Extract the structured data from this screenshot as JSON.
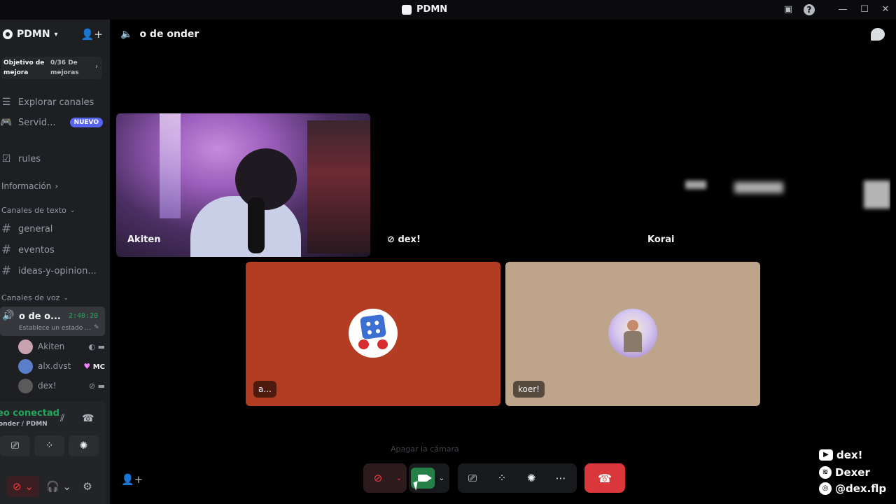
{
  "window": {
    "title": "PDMN"
  },
  "server": {
    "name": "PDMN",
    "boost": {
      "goal_label": "Objetivo de mejora",
      "progress": "0/36 De mejoras"
    }
  },
  "nav": {
    "explore": "Explorar canales",
    "servers": "Servid...",
    "servers_badge": "NUEVO",
    "rules": "rules"
  },
  "categories": {
    "info": "Información",
    "text": "Canales de texto",
    "voice": "Canales de voz"
  },
  "text_channels": [
    "general",
    "eventos",
    "ideas-y-opinion..."
  ],
  "voice_channel": {
    "name": "o de o...",
    "timer": "2:40:20",
    "status": "Establece un estado ...",
    "members": [
      {
        "name": "Akiten",
        "avatar_color": "#c9a2b0"
      },
      {
        "name": "alx.dvst",
        "tag": "MC",
        "avatar_color": "#5b7ec9"
      },
      {
        "name": "dex!",
        "avatar_color": "#5a5a5a"
      }
    ]
  },
  "connection": {
    "status": "eo conectad",
    "location": "onder / PDMN"
  },
  "call": {
    "channel_title": "o de onder",
    "tiles": {
      "akiten": "Akiten",
      "dex": "dex!",
      "korai": "Korai",
      "a": "a...",
      "koer": "koer!"
    },
    "tooltip": "Apagar la cámara",
    "tile_colors": {
      "a": "#b23d22",
      "koer": "#bea48a"
    }
  },
  "overlay": {
    "youtube": "dex!",
    "spotify": "Dexer",
    "instagram": "@dex.flp"
  },
  "colors": {
    "accent_green": "#23a55a",
    "danger_red": "#da373c",
    "brand": "#5865f2"
  }
}
